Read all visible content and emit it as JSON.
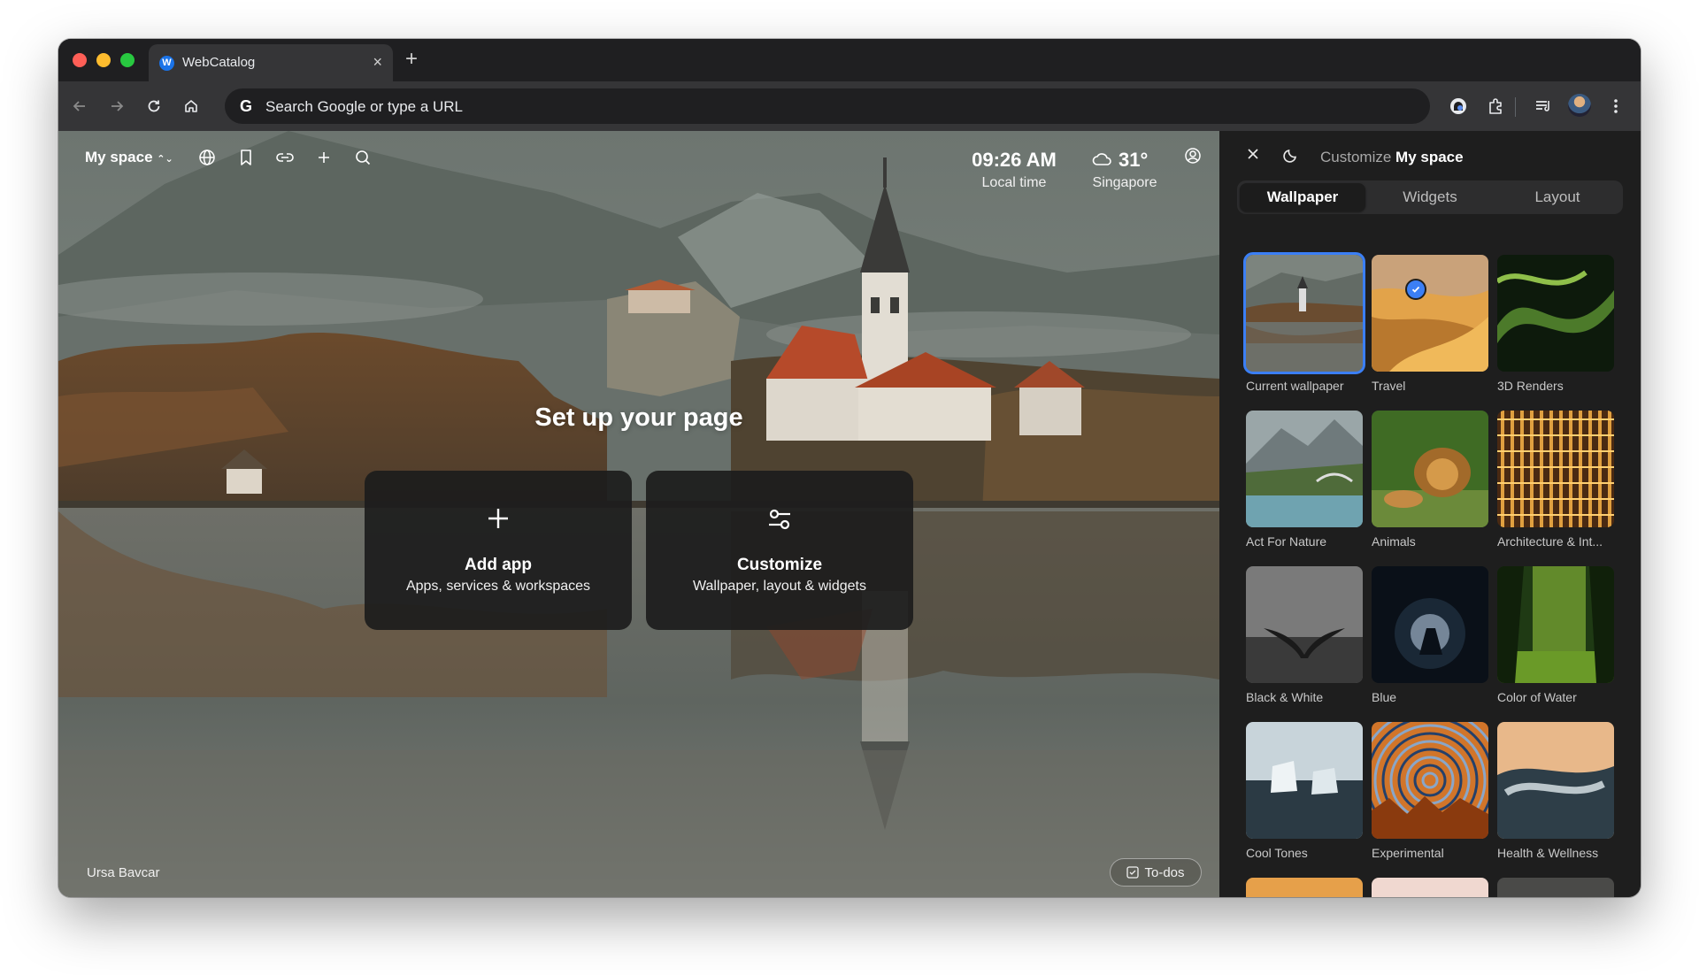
{
  "browser": {
    "tab_title": "WebCatalog",
    "tab_favicon_letter": "W",
    "omnibox_placeholder": "Search Google or type a URL"
  },
  "space": {
    "name": "My space",
    "clock_time": "09:26 AM",
    "clock_label": "Local time",
    "weather_temp": "31°",
    "weather_city": "Singapore",
    "hero_title": "Set up your page",
    "add_app": {
      "title": "Add app",
      "subtitle": "Apps, services & workspaces"
    },
    "customize": {
      "title": "Customize",
      "subtitle": "Wallpaper, layout & widgets"
    },
    "photo_credit": "Ursa Bavcar",
    "todos_label": "To-dos"
  },
  "panel": {
    "title_prefix": "Customize",
    "title_space": "My space",
    "tabs": [
      "Wallpaper",
      "Widgets",
      "Layout"
    ],
    "active_tab": "Wallpaper",
    "wallpapers": [
      {
        "label": "Current wallpaper",
        "selected": true
      },
      {
        "label": "Travel"
      },
      {
        "label": "3D Renders"
      },
      {
        "label": "Act For Nature"
      },
      {
        "label": "Animals"
      },
      {
        "label": "Architecture & Int..."
      },
      {
        "label": "Black & White"
      },
      {
        "label": "Blue"
      },
      {
        "label": "Color of Water"
      },
      {
        "label": "Cool Tones"
      },
      {
        "label": "Experimental"
      },
      {
        "label": "Health & Wellness"
      }
    ]
  },
  "colors": {
    "accent": "#3b7ff5",
    "panel_bg": "#1e1e1e",
    "toolbar_bg": "#353537"
  }
}
